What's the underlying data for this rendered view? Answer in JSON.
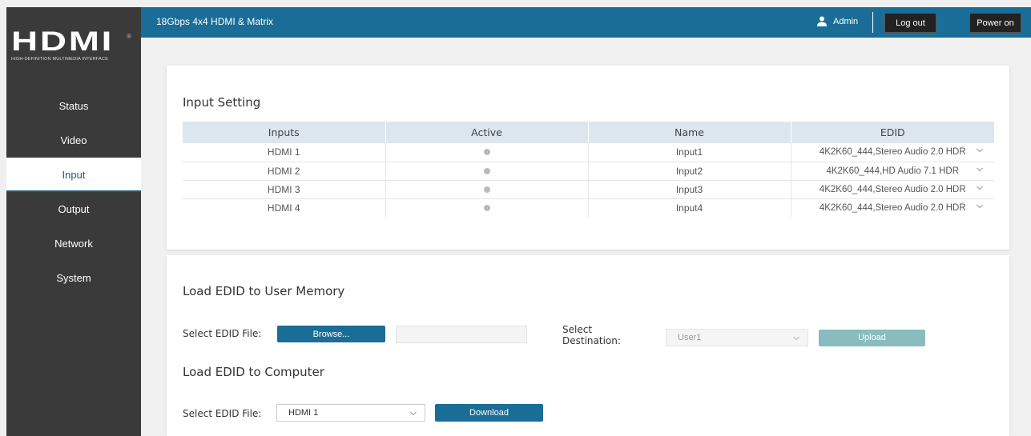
{
  "app": {
    "title": "18Gbps 4x4 HDMI & Matrix",
    "logo_word": "HDMI",
    "logo_reg": "®",
    "logo_tagline": "HIGH-DEFINITION MULTIMEDIA INTERFACE"
  },
  "header": {
    "user_icon": "user-icon",
    "user_name": "Admin",
    "logout_label": "Log out",
    "power_label": "Power on"
  },
  "nav": {
    "items": [
      {
        "label": "Status",
        "active": false
      },
      {
        "label": "Video",
        "active": false
      },
      {
        "label": "Input",
        "active": true
      },
      {
        "label": "Output",
        "active": false
      },
      {
        "label": "Network",
        "active": false
      },
      {
        "label": "System",
        "active": false
      }
    ]
  },
  "input_setting": {
    "title": "Input Setting",
    "columns": [
      "Inputs",
      "Active",
      "Name",
      "EDID"
    ],
    "rows": [
      {
        "input": "HDMI 1",
        "active": false,
        "name": "Input1",
        "edid": "4K2K60_444,Stereo Audio 2.0 HDR"
      },
      {
        "input": "HDMI 2",
        "active": false,
        "name": "Input2",
        "edid": "4K2K60_444,HD Audio 7.1 HDR"
      },
      {
        "input": "HDMI 3",
        "active": false,
        "name": "Input3",
        "edid": "4K2K60_444,Stereo Audio 2.0 HDR"
      },
      {
        "input": "HDMI 4",
        "active": false,
        "name": "Input4",
        "edid": "4K2K60_444,Stereo Audio 2.0 HDR"
      }
    ]
  },
  "load_user": {
    "title": "Load EDID to User Memory",
    "file_label": "Select EDID File:",
    "browse_label": "Browse...",
    "file_value": "",
    "dest_label_1": "Select",
    "dest_label_2": "Destination:",
    "dest_value": "User1",
    "upload_label": "Upload"
  },
  "load_computer": {
    "title": "Load EDID to Computer",
    "file_label": "Select EDID File:",
    "file_value": "HDMI 1",
    "download_label": "Download"
  },
  "colors": {
    "accent": "#1a6d96",
    "sidebar": "#3a3a3a",
    "upload_disabled": "#88bcbd"
  }
}
